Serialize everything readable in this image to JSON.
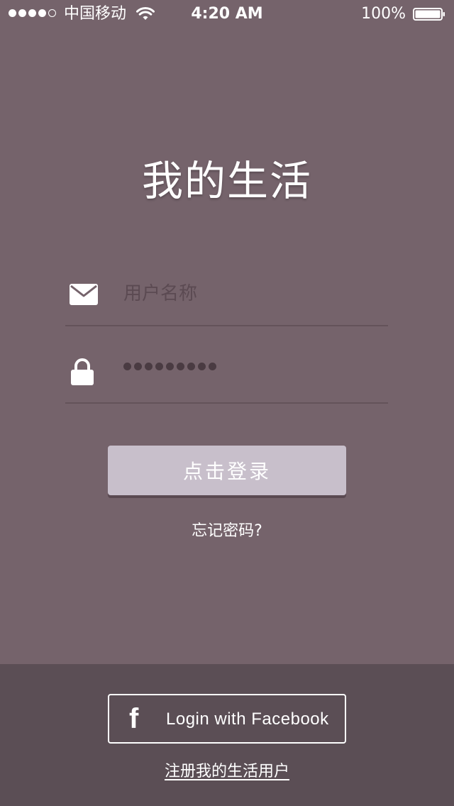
{
  "status_bar": {
    "signal_full": 4,
    "signal_total": 5,
    "carrier": "中国移动",
    "time": "4:20 AM",
    "battery_percent": "100%",
    "battery_level": 1.0,
    "icons": [
      "wifi-icon",
      "battery-icon"
    ]
  },
  "app": {
    "title": "我的生活"
  },
  "login_form": {
    "username": {
      "placeholder": "用户名称",
      "value": "",
      "icon": "envelope-icon"
    },
    "password": {
      "masked_length": 9,
      "icon": "lock-icon"
    },
    "submit_label": "点击登录",
    "forgot_label": "忘记密码?"
  },
  "social": {
    "facebook_label": "Login with Facebook",
    "facebook_icon_glyph": "f",
    "icon": "facebook-icon"
  },
  "register": {
    "label": "注册我的生活用户"
  },
  "colors": {
    "background": "#75636b",
    "bottom_panel": "#5b4e55",
    "button": "#c8bfcb",
    "divider": "#64535a"
  }
}
